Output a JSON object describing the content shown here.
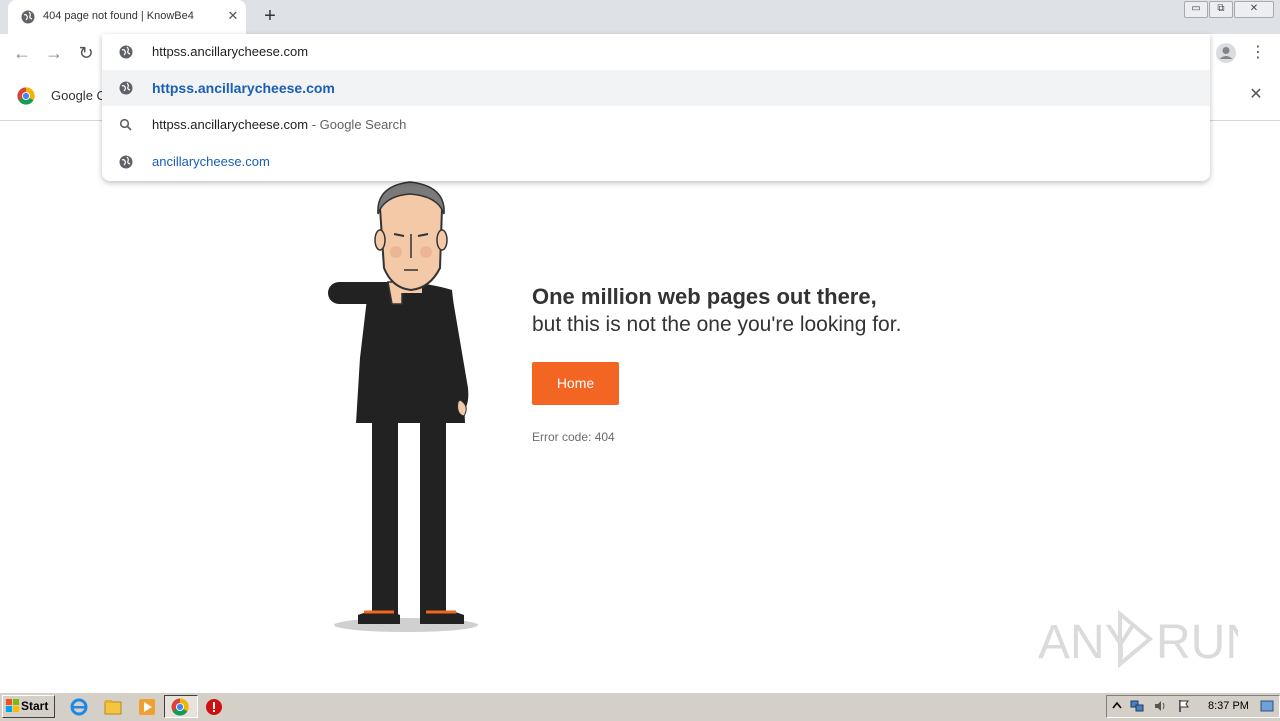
{
  "browser": {
    "tab_title": "404 page not found | KnowBe4",
    "new_tab_label": "+",
    "tab_close": "✕",
    "win_minimize": "▭",
    "win_restore": "⧉",
    "win_close": "✕",
    "nav_back": "←",
    "nav_forward": "→",
    "nav_reload": "↻",
    "menu_dots": "⋮"
  },
  "omnibox": {
    "input_value": "httpss.ancillarycheese.com",
    "suggestions": [
      {
        "text": "httpss.ancillarycheese.com",
        "suffix": "",
        "icon": "globe-icon",
        "selected": true
      },
      {
        "text": "httpss.ancillarycheese.com",
        "suffix": " - Google Search",
        "icon": "search-icon",
        "selected": false
      },
      {
        "text": "ancillarycheese.com",
        "suffix": "",
        "icon": "globe-icon",
        "selected": false
      }
    ]
  },
  "bookmarks_bar": {
    "item_label": "Google Cl",
    "close": "✕"
  },
  "page": {
    "headline_line1": "One million web pages out there,",
    "headline_line2": "but this is not the one you're looking for.",
    "home_button": "Home",
    "error_code": "Error code: 404"
  },
  "watermark": {
    "text": "ANY RUN"
  },
  "taskbar": {
    "start_label": "Start",
    "clock": "8:37 PM"
  },
  "colors": {
    "accent_orange": "#f26522",
    "link_blue": "#1a5fb4",
    "tabstrip_bg": "#dee1e6",
    "taskbar_bg": "#d4d0c8"
  }
}
